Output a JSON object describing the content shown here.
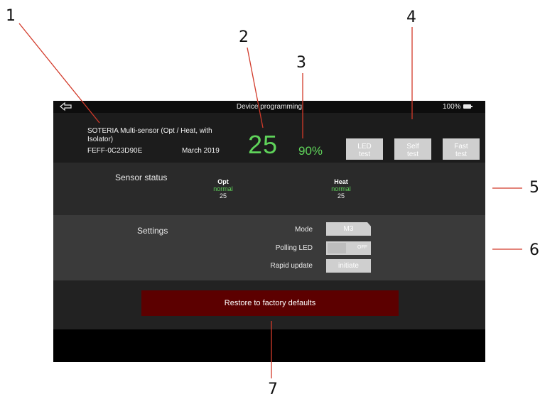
{
  "callouts": [
    "1",
    "2",
    "3",
    "4",
    "5",
    "6",
    "7"
  ],
  "status_bar": {
    "title": "Device programming",
    "battery": "100%",
    "back_icon": "back-arrow-icon"
  },
  "device": {
    "name": "SOTERIA Multi-sensor (Opt / Heat, with Isolator)",
    "serial": "FEFF-0C23D90E",
    "date": "March 2019",
    "main_value": "25",
    "percent_value": "90%"
  },
  "tests": [
    {
      "line1": "LED",
      "line2": "test"
    },
    {
      "line1": "Self",
      "line2": "test"
    },
    {
      "line1": "Fast",
      "line2": "test"
    }
  ],
  "sensor_status": {
    "label": "Sensor status",
    "sensors": [
      {
        "name": "Opt",
        "state": "normal",
        "value": "25"
      },
      {
        "name": "Heat",
        "state": "normal",
        "value": "25"
      }
    ]
  },
  "settings": {
    "label": "Settings",
    "mode_label": "Mode",
    "mode_value": "M3",
    "polling_label": "Polling LED",
    "polling_value": "OFF",
    "rapid_label": "Rapid update",
    "rapid_button": "initiate"
  },
  "restore_button": "Restore to factory defaults",
  "colors": {
    "accent_green": "#5fd35a",
    "restore_red": "#5c0000",
    "callout_line": "#d23a2a"
  }
}
